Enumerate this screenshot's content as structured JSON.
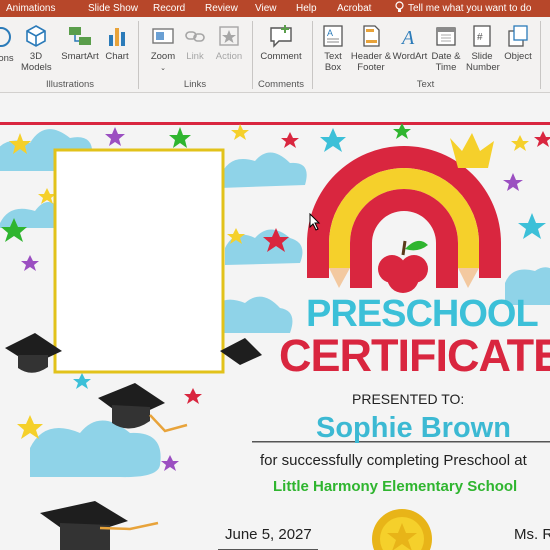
{
  "tabs": [
    "Animations",
    "Slide Show",
    "Record",
    "Review",
    "View",
    "Help",
    "Acrobat"
  ],
  "tell_me": "Tell me what you want to do",
  "ribbon": {
    "partial_icons_label": "ons",
    "models_label": "3D Models",
    "smartart_label": "SmartArt",
    "chart_label": "Chart",
    "zoom_label": "Zoom",
    "link_label": "Link",
    "action_label": "Action",
    "comment_label": "Comment",
    "textbox_label": "Text Box",
    "header_footer_label": "Header & Footer",
    "wordart_label": "WordArt",
    "datetime_label": "Date & Time",
    "slide_number_label": "Slide Number",
    "object_label": "Object",
    "groups": {
      "illustrations": "Illustrations",
      "links": "Links",
      "comments": "Comments",
      "text": "Text"
    }
  },
  "certificate": {
    "title_line1": "PRESCHOOL",
    "title_line2": "CERTIFICATE",
    "presented_to": "PRESENTED TO:",
    "recipient": "Sophie Brown",
    "description": "for successfully completing Preschool at",
    "school": "Little Harmony Elementary School",
    "date": "June 5, 2027",
    "signer_partial": "Ms. R"
  },
  "colors": {
    "ribbon_tab_bg": "#b7472a",
    "title_cyan": "#3cc0d8",
    "title_red": "#d9263f",
    "recipient_cyan": "#3cb9d3",
    "school_green": "#2fb52f",
    "border_red": "#d9263f"
  }
}
